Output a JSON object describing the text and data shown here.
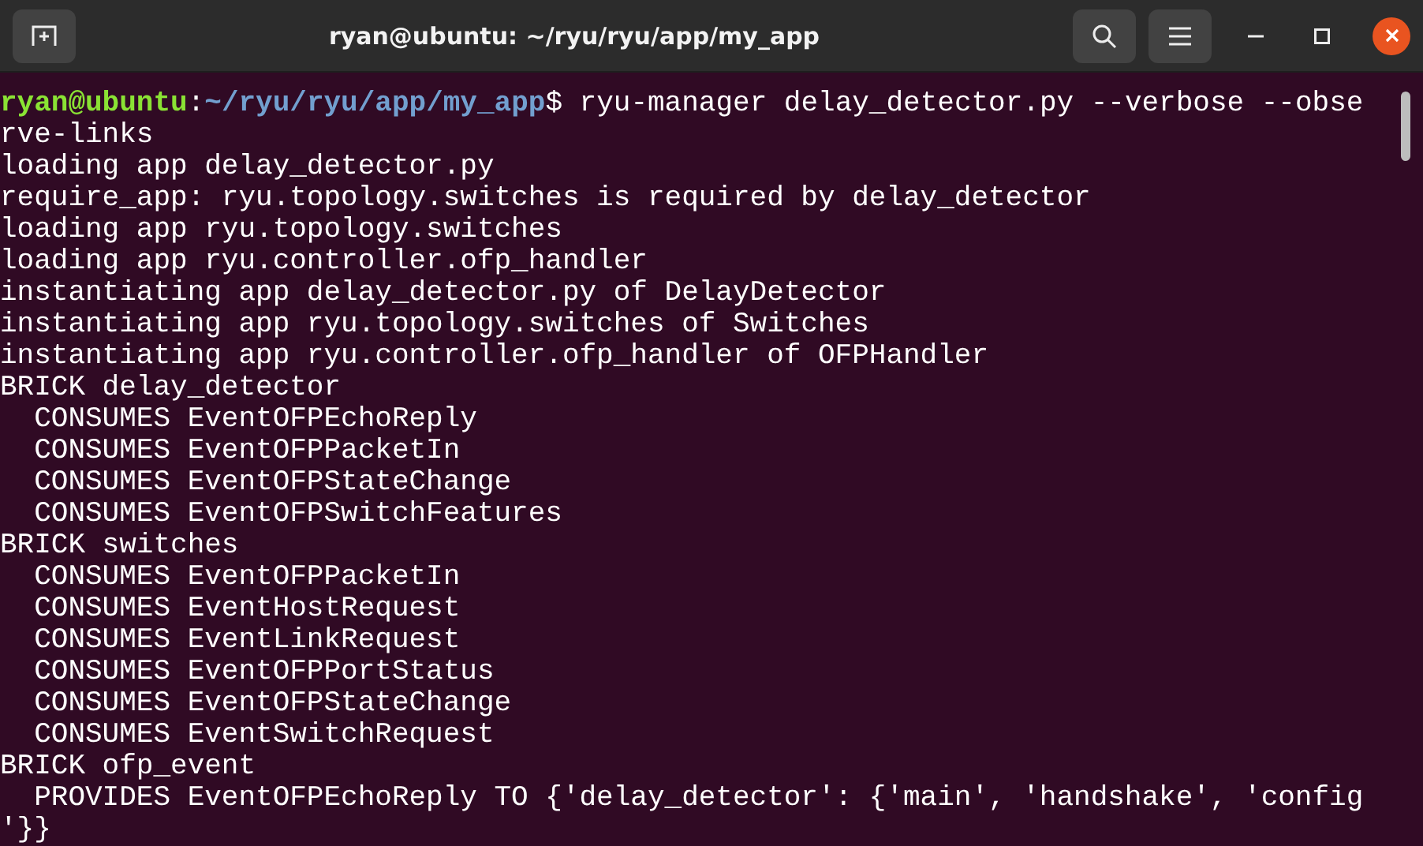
{
  "window": {
    "title": "ryan@ubuntu: ~/ryu/ryu/app/my_app"
  },
  "terminal": {
    "lines": [
      {
        "kind": "prompt",
        "user": "ryan@ubuntu",
        "separator": ":",
        "path": "~/ryu/ryu/app/my_app",
        "symbol": "$",
        "command": " ryu-manager delay_detector.py --verbose --obse"
      },
      {
        "kind": "output",
        "text": "rve-links"
      },
      {
        "kind": "output",
        "text": "loading app delay_detector.py"
      },
      {
        "kind": "output",
        "text": "require_app: ryu.topology.switches is required by delay_detector"
      },
      {
        "kind": "output",
        "text": "loading app ryu.topology.switches"
      },
      {
        "kind": "output",
        "text": "loading app ryu.controller.ofp_handler"
      },
      {
        "kind": "output",
        "text": "instantiating app delay_detector.py of DelayDetector"
      },
      {
        "kind": "output",
        "text": "instantiating app ryu.topology.switches of Switches"
      },
      {
        "kind": "output",
        "text": "instantiating app ryu.controller.ofp_handler of OFPHandler"
      },
      {
        "kind": "output",
        "text": "BRICK delay_detector"
      },
      {
        "kind": "output",
        "text": "  CONSUMES EventOFPEchoReply"
      },
      {
        "kind": "output",
        "text": "  CONSUMES EventOFPPacketIn"
      },
      {
        "kind": "output",
        "text": "  CONSUMES EventOFPStateChange"
      },
      {
        "kind": "output",
        "text": "  CONSUMES EventOFPSwitchFeatures"
      },
      {
        "kind": "output",
        "text": "BRICK switches"
      },
      {
        "kind": "output",
        "text": "  CONSUMES EventOFPPacketIn"
      },
      {
        "kind": "output",
        "text": "  CONSUMES EventHostRequest"
      },
      {
        "kind": "output",
        "text": "  CONSUMES EventLinkRequest"
      },
      {
        "kind": "output",
        "text": "  CONSUMES EventOFPPortStatus"
      },
      {
        "kind": "output",
        "text": "  CONSUMES EventOFPStateChange"
      },
      {
        "kind": "output",
        "text": "  CONSUMES EventSwitchRequest"
      },
      {
        "kind": "output",
        "text": "BRICK ofp_event"
      },
      {
        "kind": "output",
        "text": "  PROVIDES EventOFPEchoReply TO {'delay_detector': {'main', 'handshake', 'config"
      },
      {
        "kind": "output",
        "text": "'}}"
      }
    ]
  }
}
